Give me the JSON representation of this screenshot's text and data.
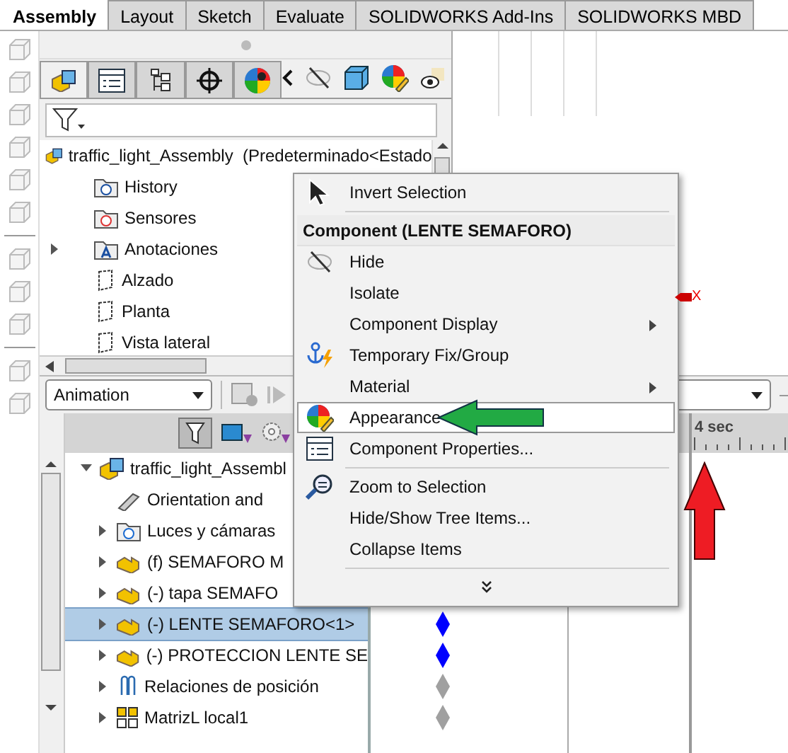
{
  "ribbon_tabs": [
    {
      "label": "Assembly",
      "selected": true
    },
    {
      "label": "Layout",
      "selected": false
    },
    {
      "label": "Sketch",
      "selected": false
    },
    {
      "label": "Evaluate",
      "selected": false
    },
    {
      "label": "SOLIDWORKS Add-Ins",
      "selected": false
    },
    {
      "label": "SOLIDWORKS MBD",
      "selected": false
    }
  ],
  "feature_manager": {
    "tabs": [
      {
        "kind": "tree",
        "selected": true
      },
      {
        "kind": "properties",
        "selected": false
      },
      {
        "kind": "configurations",
        "selected": false
      },
      {
        "kind": "dimxpert",
        "selected": false
      },
      {
        "kind": "display",
        "selected": false
      }
    ],
    "tree": {
      "root": "traffic_light_Assembly  (Predeterminado<Estado",
      "items": [
        {
          "kind": "history",
          "label": "History",
          "expandable": false
        },
        {
          "kind": "sensors",
          "label": "Sensores",
          "expandable": false
        },
        {
          "kind": "annotations",
          "label": "Anotaciones",
          "expandable": true
        },
        {
          "kind": "plane",
          "label": "Alzado",
          "expandable": false
        },
        {
          "kind": "plane",
          "label": "Planta",
          "expandable": false
        },
        {
          "kind": "plane",
          "label": "Vista lateral",
          "expandable": false
        }
      ]
    }
  },
  "graphics": {
    "triad_label": "X"
  },
  "motion_manager": {
    "study_type": "Animation",
    "timeline_label": "4 sec",
    "tree": {
      "root": "traffic_light_Assembl",
      "expanded": true,
      "children": [
        {
          "kind": "orientation",
          "label": "Orientation and",
          "expandable": false,
          "selected": false
        },
        {
          "kind": "lights",
          "label": "Luces y cámaras",
          "expandable": true,
          "selected": false
        },
        {
          "kind": "part",
          "label": "(f) SEMAFORO M",
          "expandable": true,
          "selected": false
        },
        {
          "kind": "part",
          "label": "(-) tapa SEMAFO",
          "expandable": true,
          "selected": false
        },
        {
          "kind": "part",
          "label": "(-) LENTE SEMAFORO<1>",
          "expandable": true,
          "selected": true,
          "color": "#0000ff"
        },
        {
          "kind": "part",
          "label": "(-) PROTECCION LENTE SE",
          "expandable": true,
          "selected": false,
          "color": "#0000ff"
        },
        {
          "kind": "mates",
          "label": "Relaciones de posición",
          "expandable": true,
          "selected": false,
          "color": "#a0a0a0"
        },
        {
          "kind": "pattern",
          "label": "MatrizL local1",
          "expandable": true,
          "selected": false,
          "color": "#a0a0a0"
        }
      ]
    }
  },
  "context_menu": {
    "items": [
      {
        "kind": "item",
        "label": "Invert Selection",
        "selected": false
      },
      {
        "kind": "separator"
      },
      {
        "kind": "header",
        "label": "Component (LENTE SEMAFORO)"
      },
      {
        "kind": "item",
        "label": "Hide",
        "selected": false
      },
      {
        "kind": "item",
        "label": "Isolate",
        "selected": false
      },
      {
        "kind": "submenu",
        "label": "Component Display",
        "selected": false
      },
      {
        "kind": "item",
        "label": "Temporary Fix/Group",
        "selected": false
      },
      {
        "kind": "submenu",
        "label": "Material",
        "selected": false
      },
      {
        "kind": "item",
        "label": "Appearance",
        "selected": true
      },
      {
        "kind": "item",
        "label": "Component Properties...",
        "selected": false
      },
      {
        "kind": "separator"
      },
      {
        "kind": "item",
        "label": "Zoom to Selection",
        "selected": false
      },
      {
        "kind": "item",
        "label": "Hide/Show Tree Items...",
        "selected": false
      },
      {
        "kind": "item",
        "label": "Collapse Items",
        "selected": false
      },
      {
        "kind": "separator"
      },
      {
        "kind": "more"
      }
    ]
  }
}
